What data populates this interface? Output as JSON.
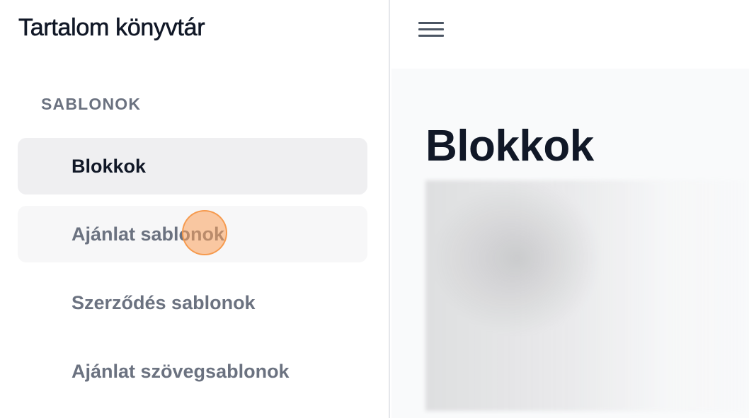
{
  "sidebar": {
    "title": "Tartalom könyvtár",
    "section_heading": "SABLONOK",
    "items": [
      {
        "label": "Blokkok",
        "state": "active"
      },
      {
        "label": "Ajánlat sablonok",
        "state": "hover"
      },
      {
        "label": "Szerződés sablonok",
        "state": "default"
      },
      {
        "label": "Ajánlat szövegsablonok",
        "state": "default"
      }
    ]
  },
  "topbar": {
    "menu_icon": "hamburger-menu-icon"
  },
  "main": {
    "page_title": "Blokkok",
    "content_state": "blurred"
  },
  "colors": {
    "active_item_bg": "#efeff1",
    "hover_item_bg": "#f7f7f8",
    "muted_text": "#6b7280",
    "primary_text": "#111827",
    "main_bg": "#f9fafb",
    "click_marker": "#fba05a"
  }
}
